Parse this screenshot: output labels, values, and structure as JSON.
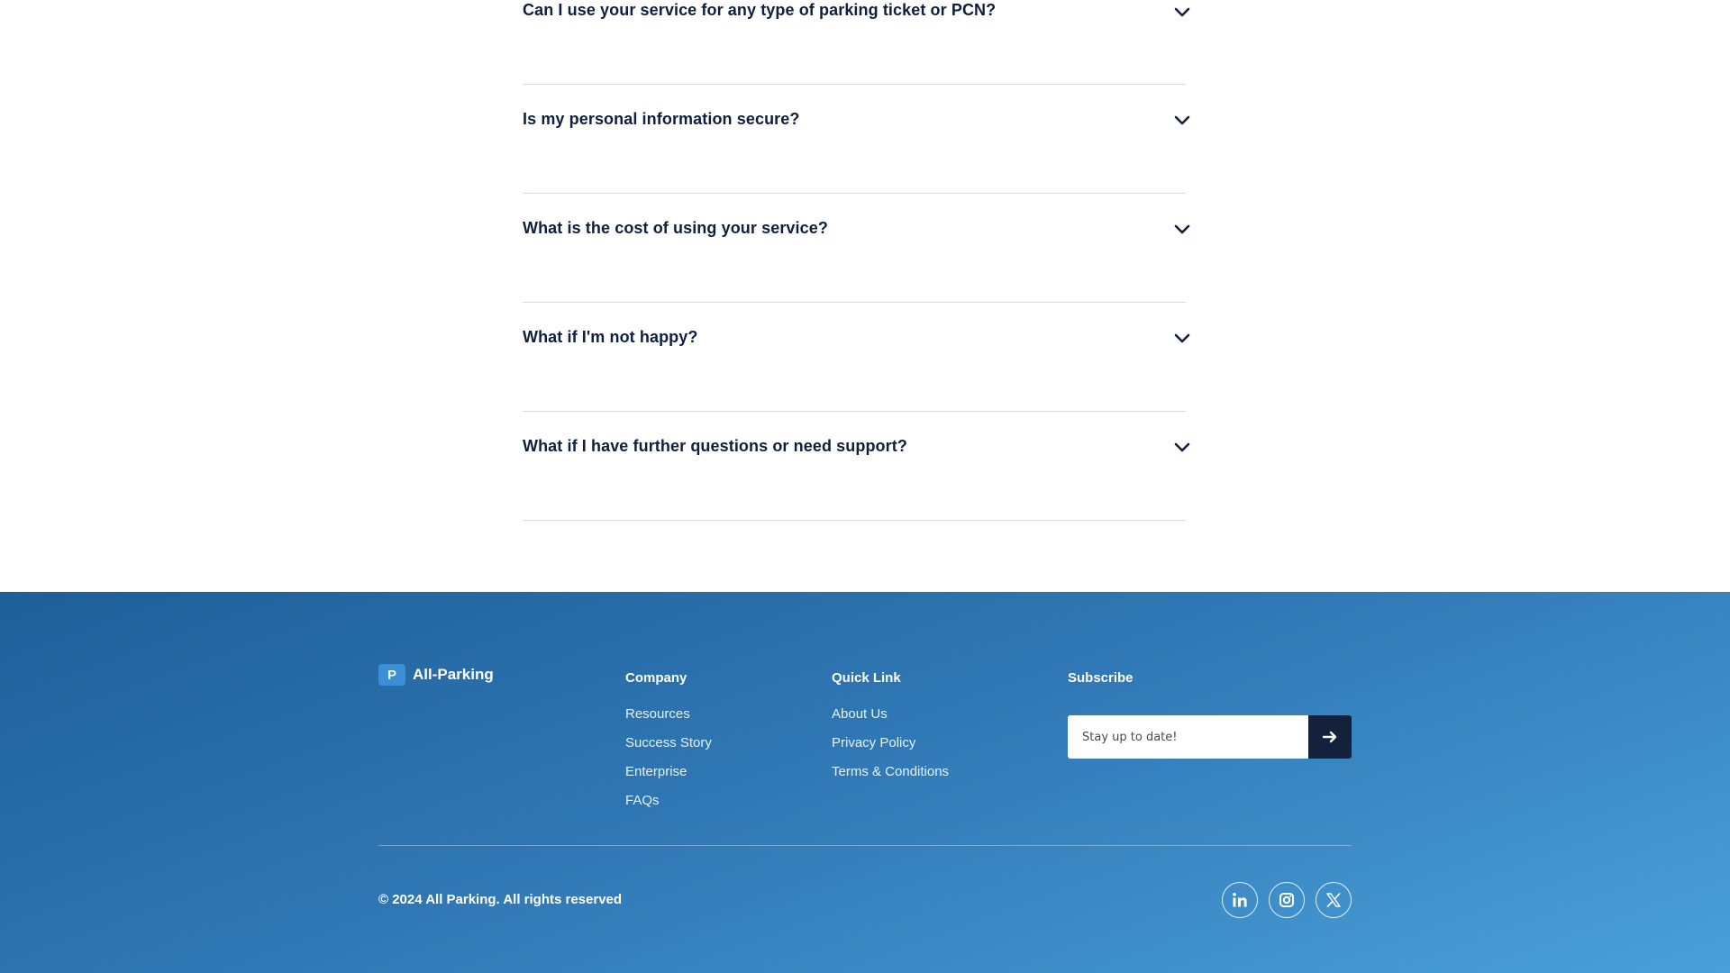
{
  "faq": {
    "items": [
      {
        "question": "Can I use your service for any type of parking ticket or PCN?"
      },
      {
        "question": "Is my personal information secure?"
      },
      {
        "question": "What is the cost of using your service?"
      },
      {
        "question": "What if I'm not happy?"
      },
      {
        "question": "What if I have further questions or need support?"
      }
    ]
  },
  "footer": {
    "brand": {
      "mark": "P",
      "name": "All-Parking"
    },
    "company": {
      "title": "Company",
      "links": [
        "Resources",
        "Success Story",
        "Enterprise",
        "FAQs"
      ]
    },
    "quick_link": {
      "title": "Quick Link",
      "links": [
        "About Us",
        "Privacy Policy",
        "Terms & Conditions"
      ]
    },
    "subscribe": {
      "title": "Subscribe",
      "placeholder": "Stay up to date!",
      "button_icon": "arrow-right-icon"
    },
    "copyright": "© 2024 All Parking. All rights reserved",
    "socials": [
      "linkedin-icon",
      "instagram-icon",
      "x-twitter-icon"
    ]
  },
  "colors": {
    "heading": "#0f1f3d",
    "footer_gradient_start": "#1e5f99",
    "footer_gradient_end": "#4aa0d9",
    "button_dark": "#14213d",
    "brand_mark": "#3a8fd6"
  }
}
